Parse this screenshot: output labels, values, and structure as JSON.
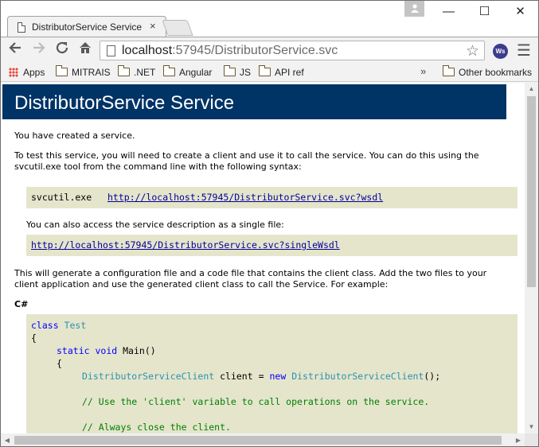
{
  "browser": {
    "tab_title": "DistributorService Service",
    "tab_close": "×",
    "url_host": "localhost",
    "url_rest": ":57945/DistributorService.svc",
    "extension_label": "Ws",
    "window_controls": {
      "minimize": "—",
      "maximize": "☐",
      "close": "✕"
    },
    "profile_icon": "person-icon",
    "bookmarks": {
      "apps": "Apps",
      "items": [
        "MITRAIS",
        ".NET",
        "Angular",
        "JS",
        "API ref"
      ],
      "more": "»",
      "other": "Other bookmarks"
    }
  },
  "page": {
    "title": "DistributorService Service",
    "intro": "You have created a service.",
    "instructions_line1": "To test this service, you will need to create a client and use it to call the service. You can do this using the",
    "instructions_line2": "svcutil.exe tool from the command line with the following syntax:",
    "svcutil_cmd": "svcutil.exe",
    "wsdl_link": "http://localhost:57945/DistributorService.svc?wsdl",
    "single_file_text": "You can also access the service description as a single file:",
    "single_wsdl_link": "http://localhost:57945/DistributorService.svc?singleWsdl",
    "generate_line1": "This will generate a configuration file and a code file that contains the client class. Add the two files to your",
    "generate_line2": "client application and use the generated client class to call the Service. For example:",
    "lang_heading": "C#",
    "code": {
      "kw_class": "class",
      "class_name": "Test",
      "brace_open": "{",
      "kw_static": "static",
      "kw_void": "void",
      "method": "Main()",
      "inner_brace_open": "{",
      "client_type": "DistributorServiceClient",
      "client_var": "client",
      "equals": "=",
      "kw_new": "new",
      "client_ctor": "DistributorServiceClient",
      "ctor_tail": "();",
      "comment1": "// Use the 'client' variable to call operations on the service.",
      "comment2": "// Always close the client."
    }
  },
  "colors": {
    "banner": "#003366",
    "code_bg": "#e5e5cc",
    "link": "#000099",
    "keyword": "#0000ff",
    "type": "#2b91af",
    "comment": "#008000"
  }
}
